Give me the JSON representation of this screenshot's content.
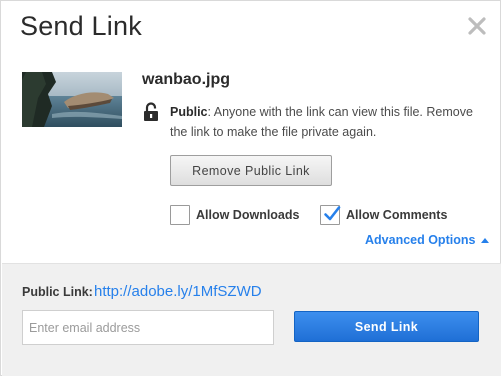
{
  "dialog": {
    "title": "Send Link",
    "close_icon": "close-icon"
  },
  "file": {
    "name": "wanbao.jpg",
    "thumbnail_icon": "image-thumbnail"
  },
  "privacy": {
    "icon": "unlocked-padlock-icon",
    "label": "Public",
    "description": ": Anyone with the link can view this file. Remove the link to make the file private again."
  },
  "actions": {
    "remove_public_link": "Remove Public Link"
  },
  "options": {
    "allow_downloads": {
      "label": "Allow Downloads",
      "checked": false
    },
    "allow_comments": {
      "label": "Allow Comments",
      "checked": true
    },
    "advanced_options": "Advanced Options"
  },
  "footer": {
    "public_link_label": "Public Link:",
    "public_link_url": "http://adobe.ly/1MfSZWD",
    "email_placeholder": "Enter email address",
    "email_value": "",
    "send_button": "Send Link"
  },
  "colors": {
    "accent": "#2680eb",
    "footer_bg": "#f0f0f0",
    "send_button": "#2b7de0"
  }
}
